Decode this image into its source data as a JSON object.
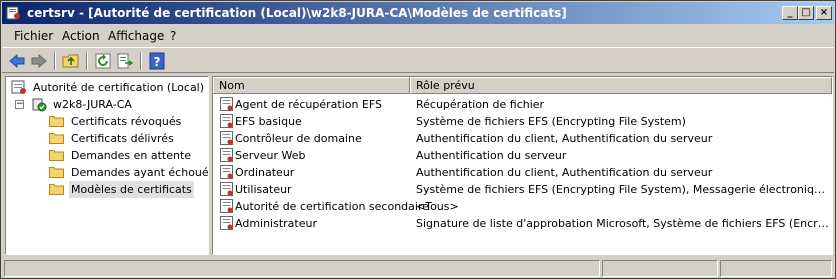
{
  "window": {
    "title": "certsrv - [Autorité de certification (Local)\\w2k8-JURA-CA\\Modèles de certificats]"
  },
  "menu": [
    {
      "label": "Fichier"
    },
    {
      "label": "Action"
    },
    {
      "label": "Affichage"
    },
    {
      "label": "?"
    }
  ],
  "toolbar": {
    "icons": [
      "back-arrow-icon",
      "forward-arrow-icon",
      "up-folder-icon",
      "refresh-icon",
      "export-list-icon",
      "help-icon"
    ]
  },
  "tree": {
    "root": "Autorité de certification (Local)",
    "ca": "w2k8-JURA-CA",
    "folders": [
      {
        "label": "Certificats révoqués"
      },
      {
        "label": "Certificats délivrés"
      },
      {
        "label": "Demandes en attente"
      },
      {
        "label": "Demandes ayant échoué"
      },
      {
        "label": "Modèles de certificats"
      }
    ]
  },
  "list": {
    "columns": [
      "Nom",
      "Rôle prévu"
    ],
    "rows": [
      {
        "name": "Agent de récupération EFS",
        "role": "Récupération de fichier"
      },
      {
        "name": "EFS basique",
        "role": "Système de fichiers EFS (Encrypting File System)"
      },
      {
        "name": "Contrôleur de domaine",
        "role": "Authentification du client, Authentification du serveur"
      },
      {
        "name": "Serveur Web",
        "role": "Authentification du serveur"
      },
      {
        "name": "Ordinateur",
        "role": "Authentification du client, Authentification du serveur"
      },
      {
        "name": "Utilisateur",
        "role": "Système de fichiers EFS (Encrypting File System), Messagerie électronique sécuris..."
      },
      {
        "name": "Autorité de certification secondaire",
        "role": "<Tous>"
      },
      {
        "name": "Administrateur",
        "role": "Signature de liste d'approbation Microsoft, Système de fichiers EFS (Encrypting Fil..."
      }
    ]
  },
  "colors": {
    "title_gradient_start": "#0a246a",
    "title_gradient_end": "#a6caf0",
    "chrome": "#d4d0c8",
    "folder": "#f5d56b"
  }
}
